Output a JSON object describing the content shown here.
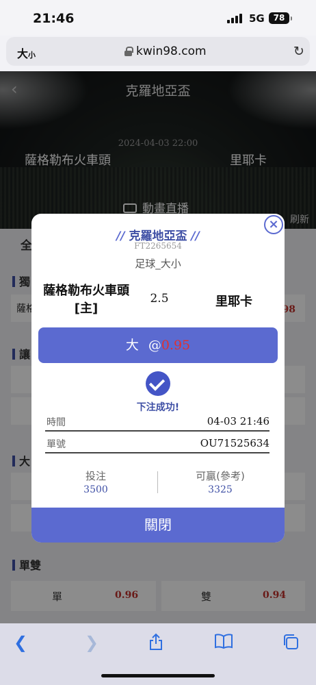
{
  "status_bar": {
    "time": "21:46",
    "network": "5G",
    "battery": "78"
  },
  "browser": {
    "text_size_button": "大",
    "text_size_small": "小",
    "url": "kwin98.com",
    "reload_icon": "reload-icon"
  },
  "header": {
    "title": "克羅地亞盃",
    "date": "2024-04-03 22:00",
    "home_team": "薩格勒布火車頭",
    "away_team": "里耶卡",
    "live_label": "動畫直播"
  },
  "background": {
    "tab_label": "全",
    "refresh_label": "刷新",
    "sections": [
      "獨",
      "讓",
      "大",
      "單雙"
    ],
    "partial_row_text": "薩格",
    "partial_odds": "98",
    "odd_even": [
      {
        "label": "單",
        "odds": "0.96"
      },
      {
        "label": "雙",
        "odds": "0.94"
      }
    ]
  },
  "modal": {
    "league": "克羅地亞盃",
    "league_prefix": "//",
    "league_suffix": "//",
    "bet_code": "FT2265654",
    "market": "足球_大小",
    "home_team": "薩格勒布火車頭",
    "home_tag": "[主]",
    "line": "2.5",
    "away_team": "里耶卡",
    "selection": "大",
    "at": "@",
    "odds": "0.95",
    "success_text": "下注成功!",
    "time_label": "時間",
    "time_value": "04-03 21:46",
    "order_label": "單號",
    "order_value": "OU71525634",
    "stake_label": "投注",
    "stake_value": "3500",
    "win_label": "可贏(參考)",
    "win_value": "3325",
    "close_button": "關閉",
    "close_icon": "×"
  },
  "colors": {
    "accent": "#5b6ad0",
    "accent_dark": "#3e4fa5",
    "odds_red": "#e03030"
  }
}
